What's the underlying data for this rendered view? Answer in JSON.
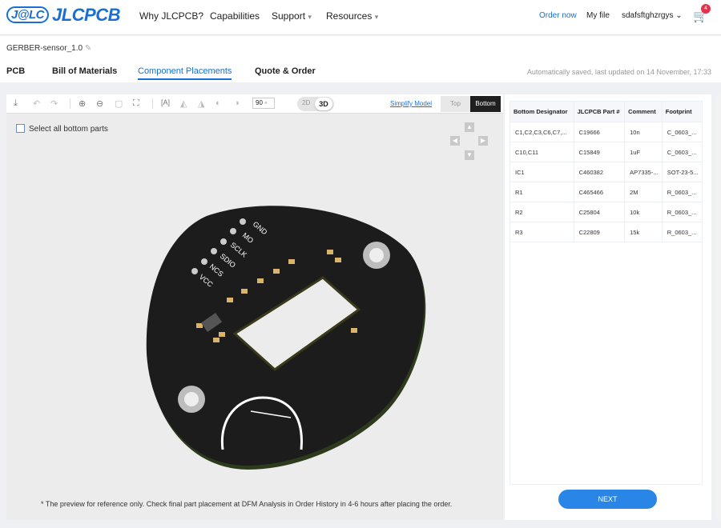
{
  "header": {
    "logo": "JLCPCB",
    "logo_badge": "J@LC",
    "nav": [
      "Why JLCPCB?",
      "Capabilities",
      "Support",
      "Resources"
    ],
    "order_now": "Order now",
    "my_file": "My file",
    "user": "sdafsftghzrgys",
    "cart_count": "4"
  },
  "project": {
    "title": "GERBER-sensor_1.0"
  },
  "tabs": [
    {
      "label": "PCB"
    },
    {
      "label": "Bill of Materials"
    },
    {
      "label": "Component Placements",
      "active": true
    },
    {
      "label": "Quote & Order"
    }
  ],
  "saved_status": "Automatically saved, last updated on 14 November, 17:33",
  "toolbar": {
    "rotation": "90",
    "mode_2d": "2D",
    "mode_3d": "3D",
    "simplify": "Simplify Model",
    "top": "Top",
    "bottom": "Bottom",
    "active_side": "Bottom",
    "active_mode": "3D"
  },
  "viewer": {
    "select_all": "Select all bottom parts",
    "pin_labels": [
      "GND",
      "MO",
      "SCLK",
      "SDIO",
      "NCS",
      "VCC"
    ],
    "note": "* The preview for reference only. Check final part placement at DFM Analysis in Order History in 4-6 hours after placing the order."
  },
  "table": {
    "headers": [
      "Bottom Designator",
      "JLCPCB Part #",
      "Comment",
      "Footprint"
    ],
    "rows": [
      [
        "C1,C2,C3,C6,C7,...",
        "C19666",
        "10n",
        "C_0603_..."
      ],
      [
        "C10,C11",
        "C15849",
        "1uF",
        "C_0603_..."
      ],
      [
        "IC1",
        "C460382",
        "AP7335-...",
        "SOT-23-5..."
      ],
      [
        "R1",
        "C465466",
        "2M",
        "R_0603_..."
      ],
      [
        "R2",
        "C25804",
        "10k",
        "R_0603_..."
      ],
      [
        "R3",
        "C22809",
        "15k",
        "R_0603_..."
      ]
    ]
  },
  "next_label": "NEXT",
  "colors": {
    "accent": "#1a6fd1",
    "button": "#2a86e6",
    "pcb": "#1c1c1c"
  }
}
